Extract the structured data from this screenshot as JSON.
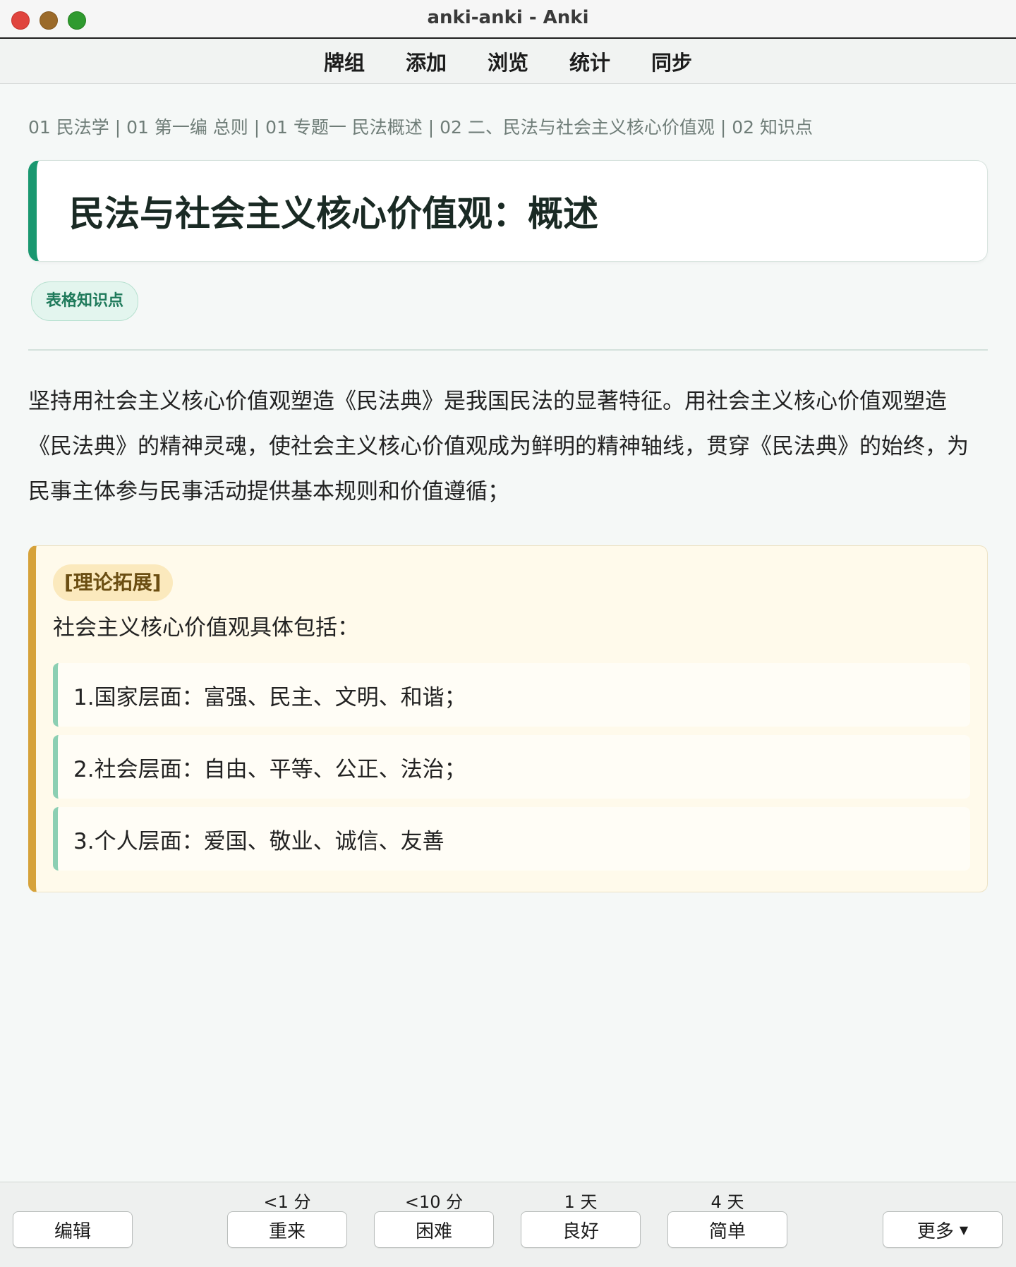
{
  "window": {
    "title": "anki-anki - Anki"
  },
  "menu": [
    "牌组",
    "添加",
    "浏览",
    "统计",
    "同步"
  ],
  "breadcrumb": "01 民法学 | 01 第一编 总则 | 01 专题一 民法概述 | 02 二、民法与社会主义核心价值观 | 02 知识点",
  "card": {
    "title": "民法与社会主义核心价值观：概述",
    "tag": "表格知识点",
    "paragraph": "坚持用社会主义核心价值观塑造《民法典》是我国民法的显著特征。用社会主义核心价值观塑造《民法典》的精神灵魂，使社会主义核心价值观成为鲜明的精神轴线，贯穿《民法典》的始终，为民事主体参与民事活动提供基本规则和价值遵循；",
    "theory": {
      "tag": "[理论拓展]",
      "intro": "社会主义核心价值观具体包括：",
      "items": [
        "1.国家层面：富强、民主、文明、和谐；",
        "2.社会层面：自由、平等、公正、法治；",
        "3.个人层面：爱国、敬业、诚信、友善"
      ]
    }
  },
  "bottom": {
    "edit": "编辑",
    "more": "更多",
    "answers": [
      {
        "interval": "<1 分",
        "label": "重来"
      },
      {
        "interval": "<10 分",
        "label": "困难"
      },
      {
        "interval": "1 天",
        "label": "良好"
      },
      {
        "interval": "4 天",
        "label": "简单"
      }
    ]
  },
  "colors": {
    "accent_green": "#1a9870",
    "accent_gold": "#d6a23a",
    "traffic_red": "#e0443e",
    "traffic_yellow": "#9b6a2a",
    "traffic_green": "#2f9a2f"
  }
}
